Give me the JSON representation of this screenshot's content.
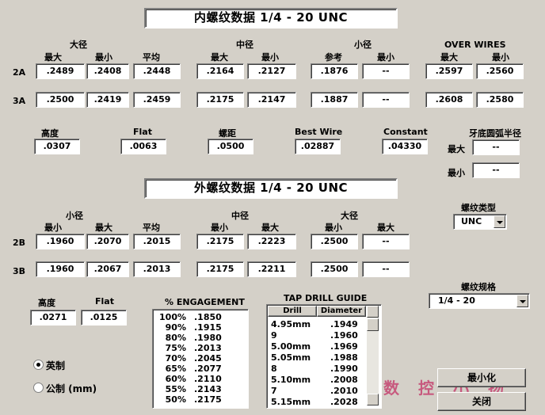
{
  "internal": {
    "title": "内螺纹数据   1/4 - 20  UNC",
    "group_headers": {
      "major": "大径",
      "pitch": "中径",
      "minor": "小径",
      "over_wires": "OVER WIRES"
    },
    "col_labels": [
      "最大",
      "最小",
      "平均",
      "最大",
      "最小",
      "参考",
      "最小",
      "最大",
      "最小"
    ],
    "rows": [
      {
        "class": "2A",
        "values": [
          ".2489",
          ".2408",
          ".2448",
          ".2164",
          ".2127",
          ".1876",
          "--",
          ".2597",
          ".2560"
        ]
      },
      {
        "class": "3A",
        "values": [
          ".2500",
          ".2419",
          ".2459",
          ".2175",
          ".2147",
          ".1887",
          "--",
          ".2608",
          ".2580"
        ]
      }
    ],
    "params": [
      {
        "label": "高度",
        "value": ".0307"
      },
      {
        "label": "Flat",
        "value": ".0063"
      },
      {
        "label": "螺距",
        "value": ".0500"
      },
      {
        "label": "Best Wire",
        "value": ".02887"
      },
      {
        "label": "Constant",
        "value": ".04330"
      }
    ],
    "root_radius": {
      "label": "牙底圆弧半径",
      "max_label": "最大",
      "max_value": "--",
      "min_label": "最小",
      "min_value": "--"
    }
  },
  "external": {
    "title": "外螺纹数据   1/4 - 20  UNC",
    "group_headers": {
      "minor": "小径",
      "pitch": "中径",
      "major": "大径"
    },
    "col_labels": [
      "最小",
      "最大",
      "平均",
      "最小",
      "最大",
      "最小",
      "最大"
    ],
    "rows": [
      {
        "class": "2B",
        "values": [
          ".1960",
          ".2070",
          ".2015",
          ".2175",
          ".2223",
          ".2500",
          "--"
        ]
      },
      {
        "class": "3B",
        "values": [
          ".1960",
          ".2067",
          ".2013",
          ".2175",
          ".2211",
          ".2500",
          "--"
        ]
      }
    ],
    "params": [
      {
        "label": "高度",
        "value": ".0271"
      },
      {
        "label": "Flat",
        "value": ".0125"
      }
    ]
  },
  "thread_type": {
    "label": "螺纹类型",
    "value": "UNC"
  },
  "thread_spec": {
    "label": "螺纹规格",
    "value": "1/4 - 20"
  },
  "engagement": {
    "title": "% ENGAGEMENT",
    "rows": [
      [
        "100%",
        ".1850"
      ],
      [
        "90%",
        ".1915"
      ],
      [
        "80%",
        ".1980"
      ],
      [
        "75%",
        ".2013"
      ],
      [
        "70%",
        ".2045"
      ],
      [
        "65%",
        ".2077"
      ],
      [
        "60%",
        ".2110"
      ],
      [
        "55%",
        ".2143"
      ],
      [
        "50%",
        ".2175"
      ]
    ]
  },
  "tap_drill": {
    "title": "TAP DRILL GUIDE",
    "headers": [
      "Drill",
      "Diameter"
    ],
    "rows": [
      [
        "4.95mm",
        ".1949"
      ],
      [
        "9",
        ".1960"
      ],
      [
        "5.00mm",
        ".1969"
      ],
      [
        "5.05mm",
        ".1988"
      ],
      [
        "8",
        ".1990"
      ],
      [
        "5.10mm",
        ".2008"
      ],
      [
        "7",
        ".2010"
      ],
      [
        "5.15mm",
        ".2028"
      ]
    ]
  },
  "units": {
    "imperial": "英制",
    "metric": "公制 (mm)",
    "selected": "imperial"
  },
  "buttons": {
    "minimize": "最小化",
    "close": "关闭"
  },
  "watermark": "数控小扬"
}
